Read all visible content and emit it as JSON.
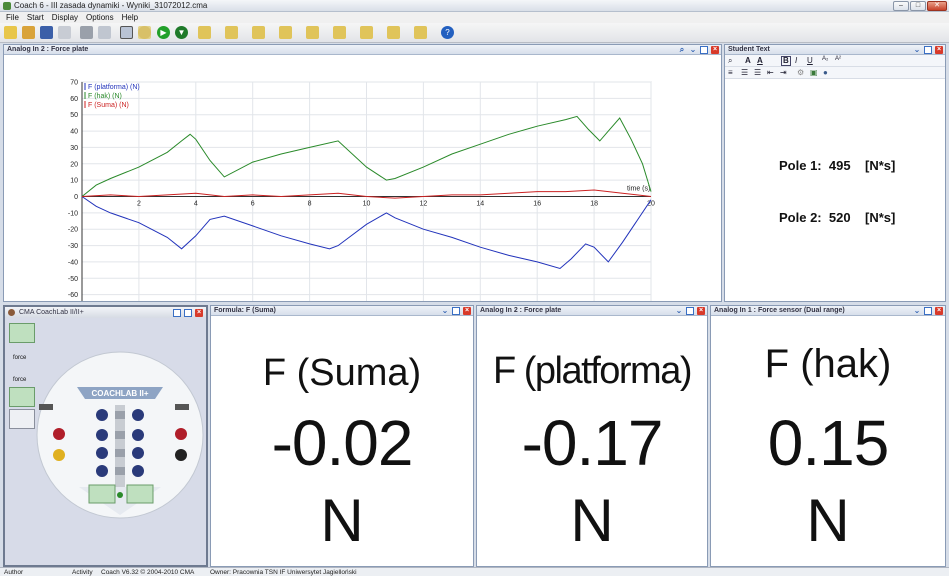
{
  "window": {
    "title": "Coach 6 - III zasada dynamiki - Wyniki_31072012.cma",
    "minimize": "–",
    "maximize": "□",
    "close": "✕"
  },
  "menu": [
    "File",
    "Start",
    "Display",
    "Options",
    "Help"
  ],
  "graph_panel": {
    "title": "Analog In 2 : Force plate",
    "legend": [
      "F (platforma) (N)",
      "F (hak) (N)",
      "F (Suma) (N)"
    ]
  },
  "chart_data": {
    "type": "line",
    "xlabel": "time (s)",
    "xlim": [
      0,
      20
    ],
    "ylim": [
      -70,
      70
    ],
    "x_ticks": [
      2,
      4,
      6,
      8,
      10,
      12,
      14,
      16,
      18,
      20
    ],
    "y_ticks": [
      70,
      60,
      50,
      40,
      30,
      20,
      10,
      0,
      -10,
      -20,
      -30,
      -40,
      -50,
      -60,
      -70
    ],
    "grid": true,
    "legend_position": "top-left",
    "series": [
      {
        "name": "F (platforma) (N)",
        "color": "#2233bb",
        "points": [
          [
            0,
            0
          ],
          [
            0.5,
            -6
          ],
          [
            1,
            -10
          ],
          [
            2,
            -16
          ],
          [
            3,
            -25
          ],
          [
            3.5,
            -32
          ],
          [
            4,
            -24
          ],
          [
            4.5,
            -14
          ],
          [
            5,
            -12
          ],
          [
            6,
            -18
          ],
          [
            7,
            -24
          ],
          [
            8,
            -29
          ],
          [
            8.7,
            -32
          ],
          [
            9,
            -30
          ],
          [
            10,
            -17
          ],
          [
            10.7,
            -10
          ],
          [
            11,
            -13
          ],
          [
            12,
            -20
          ],
          [
            13,
            -25
          ],
          [
            14,
            -31
          ],
          [
            15,
            -36
          ],
          [
            16,
            -40
          ],
          [
            16.8,
            -44
          ],
          [
            17.2,
            -38
          ],
          [
            17.7,
            -29
          ],
          [
            18,
            -31
          ],
          [
            18.5,
            -40
          ],
          [
            19,
            -28
          ],
          [
            19.5,
            -15
          ],
          [
            20,
            -2
          ]
        ]
      },
      {
        "name": "F (hak) (N)",
        "color": "#2a8a2a",
        "points": [
          [
            0,
            0
          ],
          [
            0.5,
            7
          ],
          [
            1,
            11
          ],
          [
            2,
            18
          ],
          [
            3,
            27
          ],
          [
            3.5,
            34
          ],
          [
            3.8,
            38
          ],
          [
            4,
            35
          ],
          [
            4.5,
            22
          ],
          [
            5,
            12
          ],
          [
            6,
            21
          ],
          [
            7,
            26
          ],
          [
            8,
            30
          ],
          [
            9,
            34
          ],
          [
            10,
            18
          ],
          [
            10.7,
            10
          ],
          [
            11,
            11
          ],
          [
            12,
            18
          ],
          [
            13,
            26
          ],
          [
            14,
            32
          ],
          [
            15,
            38
          ],
          [
            16,
            43
          ],
          [
            17,
            47
          ],
          [
            17.4,
            49
          ],
          [
            17.8,
            41
          ],
          [
            18.2,
            34
          ],
          [
            18.5,
            40
          ],
          [
            18.9,
            48
          ],
          [
            19.3,
            35
          ],
          [
            19.7,
            20
          ],
          [
            20,
            3
          ]
        ]
      },
      {
        "name": "F (Suma) (N)",
        "color": "#cc2222",
        "points": [
          [
            0,
            0
          ],
          [
            1,
            1
          ],
          [
            2,
            0
          ],
          [
            3,
            1
          ],
          [
            4,
            2
          ],
          [
            5,
            0
          ],
          [
            6,
            1
          ],
          [
            7,
            0
          ],
          [
            8,
            1
          ],
          [
            9,
            2
          ],
          [
            10,
            0
          ],
          [
            11,
            -1
          ],
          [
            12,
            0
          ],
          [
            13,
            1
          ],
          [
            14,
            1
          ],
          [
            15,
            2
          ],
          [
            16,
            3
          ],
          [
            17,
            3
          ],
          [
            18,
            4
          ],
          [
            19,
            2
          ],
          [
            20,
            0
          ]
        ]
      }
    ]
  },
  "student_text": {
    "title": "Student Text",
    "pole1_label": "Pole 1:",
    "pole1_value": "495",
    "pole1_unit": "[N*s]",
    "pole2_label": "Pole 2:",
    "pole2_value": "520",
    "pole2_unit": "[N*s]"
  },
  "coachlab": {
    "title": "CMA CoachLab II/II+",
    "logo": "COACHLAB II+",
    "slot_labels": [
      "force",
      "force"
    ],
    "button_label": "force"
  },
  "meters": [
    {
      "title": "Formula: F (Suma)",
      "name": "F (Suma)",
      "value": "-0.02",
      "unit": "N"
    },
    {
      "title": "Analog In 2 : Force plate",
      "name": "F (platforma)",
      "value": "-0.17",
      "unit": "N"
    },
    {
      "title": "Analog In 1 : Force sensor (Dual range)",
      "name": "F (hak)",
      "value": "0.15",
      "unit": "N"
    }
  ],
  "status": {
    "mode": "Author",
    "activity": "Activity",
    "version": "Coach V6.32 © 2004-2010 CMA",
    "owner": "Owner: Pracownia TSN IF Uniwersytet Jagielloński"
  }
}
